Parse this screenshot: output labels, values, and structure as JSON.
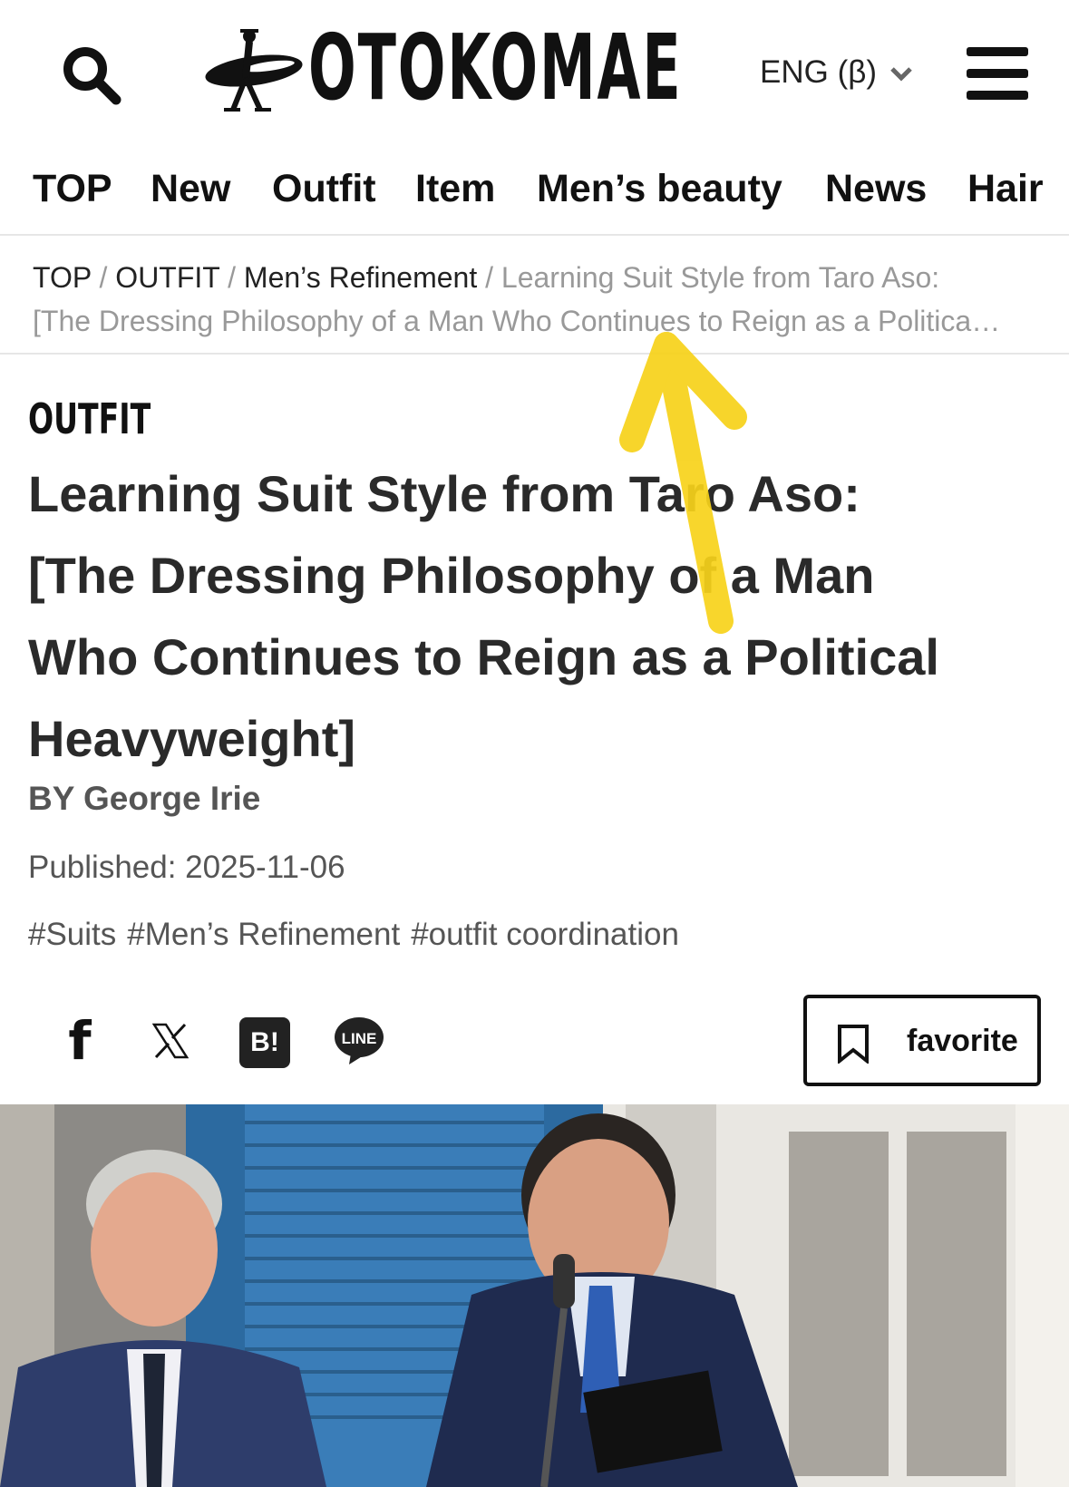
{
  "header": {
    "logo_text": "OTOKOMAE",
    "language_label": "ENG (β)",
    "icons": [
      "search-icon",
      "surfer-logo-icon",
      "chevron-down-icon",
      "hamburger-menu-icon"
    ]
  },
  "nav": {
    "items": [
      "TOP",
      "New",
      "Outfit",
      "Item",
      "Men’s beauty",
      "News",
      "Hair"
    ]
  },
  "breadcrumb": {
    "items": [
      "TOP",
      "OUTFIT",
      "Men’s Refinement"
    ],
    "separator": "/",
    "current_line1": "Learning Suit Style from Taro Aso:",
    "current_line2": "[The Dressing Philosophy of a Man Who Continues to Reign as a Politica…"
  },
  "article": {
    "category": "OUTFIT",
    "title_lines": [
      "Learning Suit Style from Taro Aso:",
      "[The Dressing Philosophy of a Man",
      "Who Continues to Reign as a Political",
      "Heavyweight]"
    ],
    "byline": "BY George Irie",
    "published": "Published: 2025-11-06",
    "tags": [
      "#Suits",
      "#Men’s Refinement",
      "#outfit coordination"
    ]
  },
  "share": {
    "facebook_label": "f",
    "hatena_label": "B!",
    "line_label": "LINE",
    "favorite_label": "favorite",
    "icons": [
      "facebook-icon",
      "x-icon",
      "hatena-bookmark-icon",
      "line-icon",
      "bookmark-icon"
    ]
  },
  "colors": {
    "text_dark": "#111111",
    "text_gray": "#555555",
    "breadcrumb_gray": "#999999",
    "divider": "#e6e6e6",
    "annotation_arrow": "#f7d21a"
  }
}
